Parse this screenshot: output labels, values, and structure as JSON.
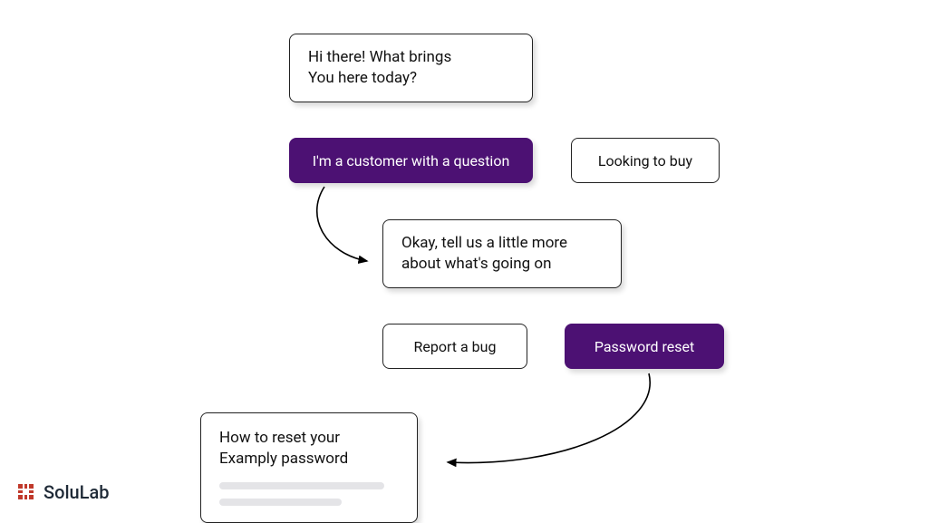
{
  "step1": {
    "prompt_line1": "Hi there! What brings",
    "prompt_line2": "You here today?",
    "option_a": "I'm a customer with a question",
    "option_b": "Looking to buy"
  },
  "step2": {
    "prompt_line1": "Okay, tell us a little more",
    "prompt_line2": "about what's going on",
    "option_a": "Report a bug",
    "option_b": "Password reset"
  },
  "result": {
    "title_line1": "How to reset your",
    "title_line2": "Examply password"
  },
  "brand": {
    "name": "SoluLab"
  },
  "colors": {
    "accent": "#4c1173"
  }
}
